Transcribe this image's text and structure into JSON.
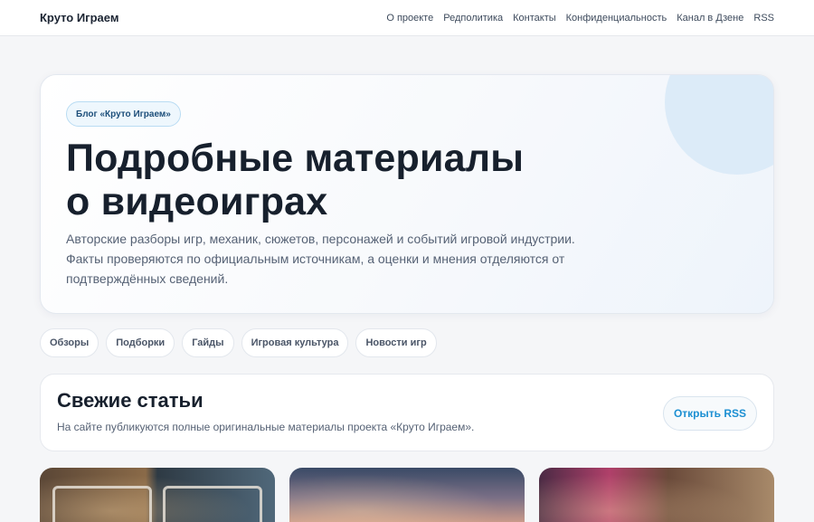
{
  "header": {
    "brand": "Круто Играем",
    "nav": [
      {
        "label": "О проекте"
      },
      {
        "label": "Редполитика"
      },
      {
        "label": "Контакты"
      },
      {
        "label": "Конфиденциальность"
      },
      {
        "label": "Канал в Дзене"
      },
      {
        "label": "RSS"
      }
    ]
  },
  "hero": {
    "badge": "Блог «Круто Играем»",
    "title_line1": "Подробные материалы",
    "title_line2": "о видеоиграх",
    "description": "Авторские разборы игр, механик, сюжетов, персонажей и событий игровой индустрии. Факты проверяются по официальным источникам, а оценки и мнения отделяются от подтверждённых сведений."
  },
  "categories": [
    {
      "label": "Обзоры"
    },
    {
      "label": "Подборки"
    },
    {
      "label": "Гайды"
    },
    {
      "label": "Игровая культура"
    },
    {
      "label": "Новости игр"
    }
  ],
  "fresh": {
    "title": "Свежие статьи",
    "description": "На сайте публикуются полные оригинальные материалы проекта «Круто Играем».",
    "rss_button": "Открыть RSS"
  }
}
